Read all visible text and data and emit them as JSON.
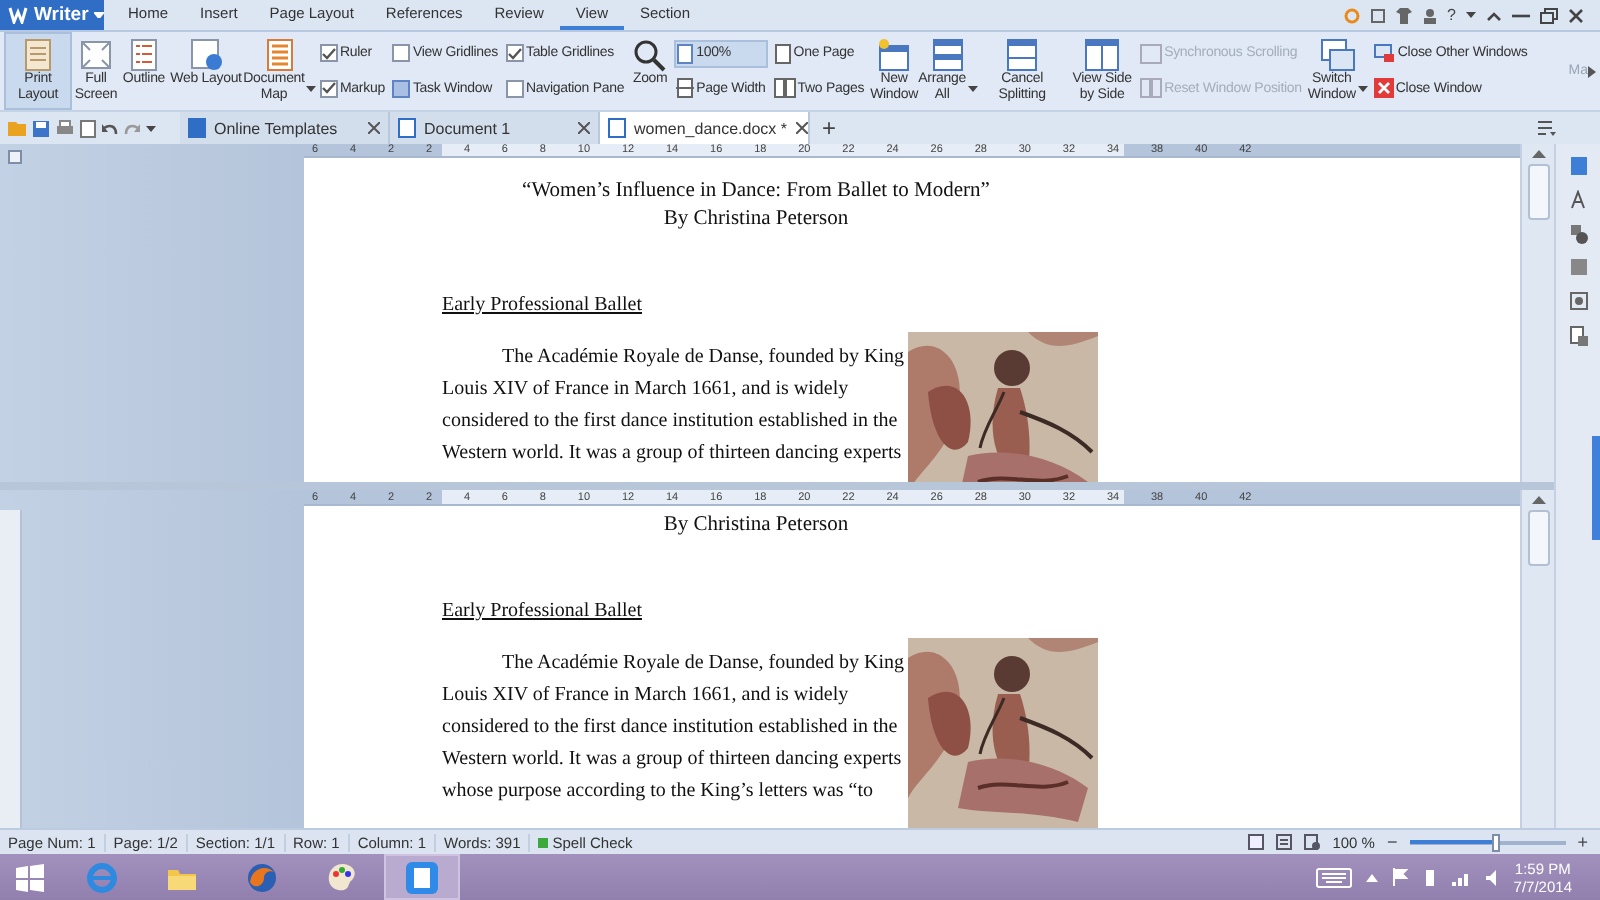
{
  "app_menu": {
    "label": "Writer"
  },
  "menu_tabs": [
    {
      "label": "Home",
      "selected": false
    },
    {
      "label": "Insert",
      "selected": false
    },
    {
      "label": "Page Layout",
      "selected": false
    },
    {
      "label": "References",
      "selected": false
    },
    {
      "label": "Review",
      "selected": false
    },
    {
      "label": "View",
      "selected": true
    },
    {
      "label": "Section",
      "selected": false
    }
  ],
  "help": "?",
  "ribbon": {
    "groups": [
      {
        "kind": "large",
        "label": "Print Layout",
        "selected": true
      },
      {
        "kind": "large",
        "label": "Full Screen",
        "selected": false
      },
      {
        "kind": "large",
        "label": "Outline",
        "selected": false
      },
      {
        "kind": "large",
        "label": "Web Layout",
        "selected": false
      },
      {
        "kind": "large",
        "label": "Document Map",
        "dropdown": true
      },
      {
        "kind": "stack",
        "items": [
          {
            "kind": "checkbox",
            "label": "Ruler",
            "checked": true
          },
          {
            "kind": "checkbox",
            "label": "Markup",
            "checked": true
          }
        ]
      },
      {
        "kind": "stack",
        "items": [
          {
            "kind": "checkbox",
            "label": "View Gridlines",
            "checked": false
          },
          {
            "kind": "button",
            "label": "Task Window"
          }
        ]
      },
      {
        "kind": "stack",
        "items": [
          {
            "kind": "checkbox",
            "label": "Table Gridlines",
            "checked": true
          },
          {
            "kind": "checkbox",
            "label": "Navigation Pane",
            "checked": false
          }
        ]
      },
      {
        "kind": "large",
        "label": "Zoom"
      },
      {
        "kind": "stack",
        "items": [
          {
            "kind": "button",
            "label": "100%",
            "selected": true
          },
          {
            "kind": "button",
            "label": "Page Width",
            "selected": false
          }
        ]
      },
      {
        "kind": "stack",
        "items": [
          {
            "kind": "button",
            "label": "One Page"
          },
          {
            "kind": "button",
            "label": "Two Pages"
          }
        ]
      },
      {
        "kind": "large",
        "label": "New Window"
      },
      {
        "kind": "large",
        "label": "Arrange All",
        "dropdown": true
      },
      {
        "kind": "large",
        "label": "Cancel Splitting"
      },
      {
        "kind": "large",
        "label": "View Side by Side"
      },
      {
        "kind": "stack",
        "items": [
          {
            "kind": "button",
            "label": "Synchronous Scrolling",
            "disabled": true
          },
          {
            "kind": "button",
            "label": "Reset Window Position",
            "disabled": true
          }
        ]
      },
      {
        "kind": "large",
        "label": "Switch Window",
        "dropdown": true
      },
      {
        "kind": "stack",
        "items": [
          {
            "kind": "button",
            "label": "Close Other Windows"
          },
          {
            "kind": "button",
            "label": "Close Window"
          }
        ]
      }
    ],
    "overflow_label": "Ma"
  },
  "doc_tabs": [
    {
      "label": "Online Templates",
      "selected": false
    },
    {
      "label": "Document 1",
      "selected": false
    },
    {
      "label": "women_dance.docx *",
      "selected": true
    }
  ],
  "new_tab": "+",
  "panes": [
    {
      "ruler": [
        "6",
        "4",
        "2",
        "2",
        "4",
        "6",
        "8",
        "10",
        "12",
        "14",
        "16",
        "18",
        "20",
        "22",
        "24",
        "26",
        "28",
        "30",
        "32",
        "34",
        "38",
        "40",
        "42"
      ],
      "title": "“Women’s Influence in Dance: From Ballet to Modern”",
      "author": "By Christina Peterson",
      "heading": "Early Professional Ballet",
      "lines": [
        "The Académie Royale de Danse, founded by King",
        "Louis XIV of France in March 1661, and is widely",
        "considered to the first dance institution established in the",
        "Western world. It was a group of thirteen dancing experts"
      ]
    },
    {
      "ruler": [
        "6",
        "4",
        "2",
        "2",
        "4",
        "6",
        "8",
        "10",
        "12",
        "14",
        "16",
        "18",
        "20",
        "22",
        "24",
        "26",
        "28",
        "30",
        "32",
        "34",
        "38",
        "40",
        "42"
      ],
      "author": "By Christina Peterson",
      "heading": "Early Professional Ballet",
      "lines": [
        "The Académie Royale de Danse, founded by King",
        "Louis XIV of France in March 1661, and is widely",
        "considered to the first dance institution established in the",
        "Western world. It was a group of thirteen dancing experts",
        "whose purpose according to the King’s letters was “to"
      ]
    }
  ],
  "status_bar": {
    "items": [
      "Page Num: 1",
      "Page: 1/2",
      "Section: 1/1",
      "Row: 1",
      "Column: 1",
      "Words: 391"
    ],
    "spell_check": "Spell Check",
    "zoom": "100 %",
    "zoom_out": "−",
    "zoom_in": "+",
    "zoom_slider": {
      "level": 0.56
    }
  },
  "taskbar": {
    "apps": [
      {
        "selected": false
      },
      {
        "selected": false
      },
      {
        "selected": false
      },
      {
        "selected": false
      },
      {
        "selected": true
      }
    ],
    "time": "1:59 PM",
    "date": "7/7/2014"
  }
}
